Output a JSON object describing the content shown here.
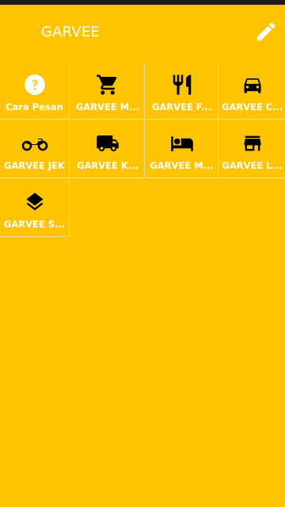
{
  "app": {
    "title": "GARVEE"
  },
  "header": {
    "edit_icon": "pencil-icon"
  },
  "colors": {
    "background": "#FFC400",
    "text": "#FFFFFF",
    "icon": "#000000"
  },
  "menu": {
    "items": [
      {
        "label": "Cara Pesan",
        "icon": "help-circle-icon"
      },
      {
        "label": "GARVEE M...",
        "icon": "shopping-cart-icon"
      },
      {
        "label": "GARVEE F...",
        "icon": "fork-knife-icon"
      },
      {
        "label": "GARVEE C...",
        "icon": "car-icon"
      },
      {
        "label": "GARVEE JEK",
        "icon": "motorcycle-icon"
      },
      {
        "label": "GARVEE K...",
        "icon": "truck-icon"
      },
      {
        "label": "GARVEE M...",
        "icon": "bed-icon"
      },
      {
        "label": "GARVEE L...",
        "icon": "store-icon"
      },
      {
        "label": "GARVEE S...",
        "icon": "layers-icon"
      }
    ]
  }
}
